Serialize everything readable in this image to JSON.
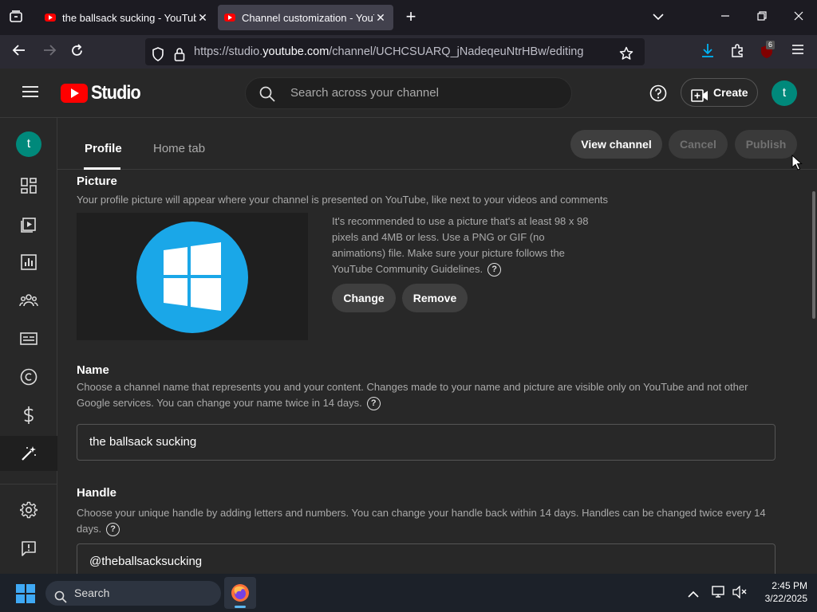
{
  "browser": {
    "tabs": [
      {
        "title": "the ballsack sucking - YouTube",
        "active": false
      },
      {
        "title": "Channel customization - YouTube",
        "active": true
      }
    ],
    "url_prefix": "https://studio.",
    "url_domain": "youtube.com",
    "url_path": "/channel/UCHCSUARQ_jNadeqeuNtrHBw/editing",
    "extension_badge": "6"
  },
  "studio": {
    "logo_text": "Studio",
    "search_placeholder": "Search across your channel",
    "create_label": "Create",
    "avatar_letter": "t"
  },
  "sidebar": {
    "avatar_letter": "t",
    "items": [
      "dashboard",
      "content",
      "analytics",
      "community",
      "subtitles",
      "copyright",
      "earn",
      "customization",
      "settings",
      "send-feedback"
    ]
  },
  "page": {
    "tabs": [
      {
        "label": "Profile",
        "active": true
      },
      {
        "label": "Home tab",
        "active": false
      }
    ],
    "view_channel_label": "View channel",
    "cancel_label": "Cancel",
    "publish_label": "Publish",
    "picture": {
      "title": "Picture",
      "description": "Your profile picture will appear where your channel is presented on YouTube, like next to your videos and comments",
      "recommendation": "It's recommended to use a picture that's at least 98 x 98 pixels and 4MB or less. Use a PNG or GIF (no animations) file. Make sure your picture follows the YouTube Community Guidelines.",
      "change_label": "Change",
      "remove_label": "Remove"
    },
    "name": {
      "title": "Name",
      "description": "Choose a channel name that represents you and your content. Changes made to your name and picture are visible only on YouTube and not other Google services. You can change your name twice in 14 days.",
      "value": "the ballsack sucking"
    },
    "handle": {
      "title": "Handle",
      "description": "Choose your unique handle by adding letters and numbers. You can change your handle back within 14 days. Handles can be changed twice every 14 days.",
      "value": "@theballsacksucking"
    }
  },
  "taskbar": {
    "search_label": "Search",
    "time": "2:45 PM",
    "date": "3/22/2025"
  },
  "colors": {
    "youtube_red": "#ff0000",
    "avatar_teal": "#00897b",
    "windows_blue": "#1aa7e8",
    "download_blue": "#00b3f4"
  }
}
